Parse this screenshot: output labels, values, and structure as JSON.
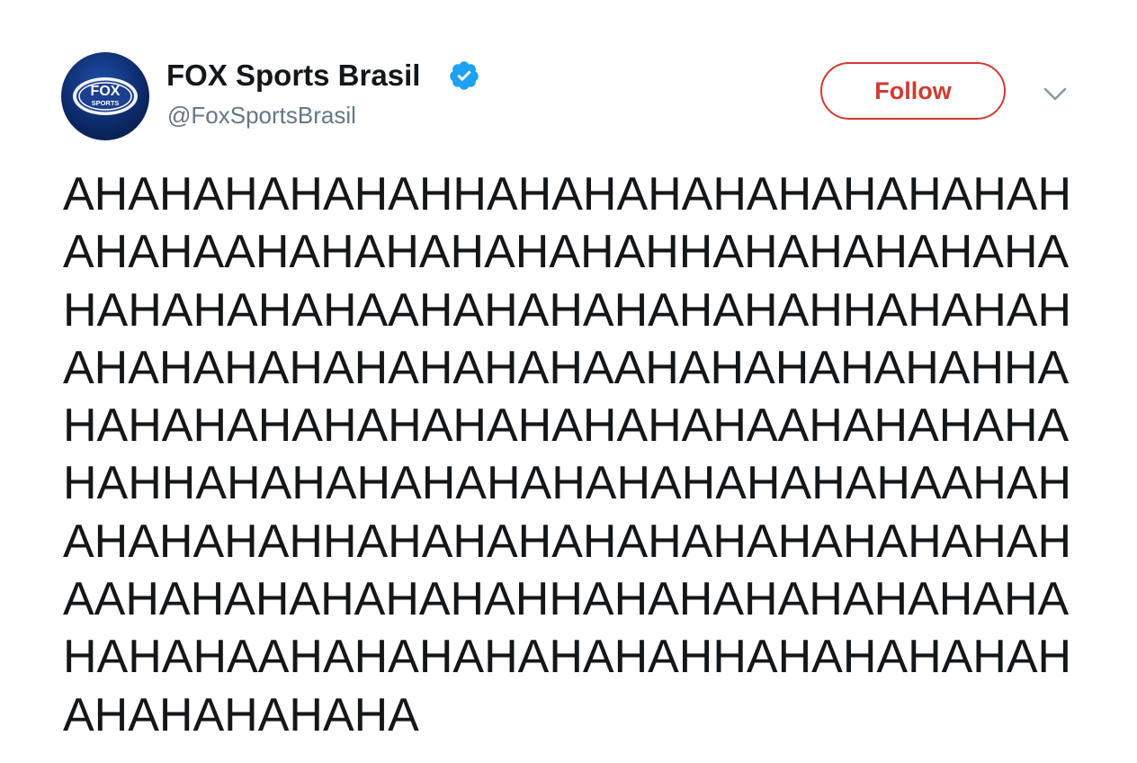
{
  "account": {
    "display_name": "FOX Sports Brasil",
    "handle": "@FoxSportsBrasil",
    "verified": true,
    "avatar_text": "FOX SPORTS"
  },
  "actions": {
    "follow_label": "Follow",
    "follow_color": "#d03b30"
  },
  "tweet": {
    "lines": [
      "AHAHAHAHAHAHHAHAHAHAHAHAHAHAHAH",
      "AHAHAAHAHAHAHAHAHAHHAHAHAHAHAHA",
      "HAHAHAHAHAAHAHAHAHAHAHAHHAHAHAH",
      "AHAHAHAHAHAHAHAHAAHAHAHAHAHAHHA",
      "HAHAHAHAHAHAHAHAHAHAHAAHAHAHAHA",
      "HAHHAHAHAHAHAHAHAHAHAHAHAHAAHAH",
      "AHAHAHAHHAHAHAHAHAHAHAHAHAHAHAH",
      "AAHAHAHAHAHAHAHHAHAHAHAHAHAHAHA",
      "HAHAHAAHAHAHAHAHAHAHHAHAHAHAHAH",
      "AHAHAHAHAHA"
    ]
  },
  "icons": {
    "verified": "verified-badge-icon",
    "caret": "chevron-down-icon"
  },
  "colors": {
    "verified_blue": "#1da1f2",
    "text": "#14171a",
    "secondary": "#657786"
  }
}
